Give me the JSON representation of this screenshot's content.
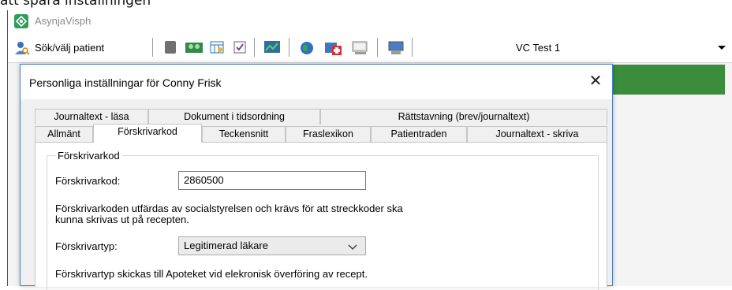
{
  "caption": "att spara inställningen",
  "app": {
    "title": "AsynjaVisph",
    "toolbar": {
      "search_label": "Sök/välj patient",
      "unit_label": "VC Test 1",
      "icons": [
        "user-search-icon",
        "notebook-icon",
        "patients-icon",
        "calendar-icon",
        "checklist-icon",
        "monitor-chart-icon",
        "globe-icon",
        "medical-kit-icon",
        "keyboard-icon",
        "computer-icon"
      ]
    }
  },
  "dialog": {
    "title": "Personliga inställningar för Conny Frisk",
    "close_glyph": "✕",
    "tabs_back": [
      "Journaltext - läsa",
      "Dokument i tidsordning",
      "Rättstavning (brev/journaltext)"
    ],
    "tabs_front": [
      "Allmänt",
      "Förskrivarkod",
      "Teckensnitt",
      "Fraslexikon",
      "Patientraden",
      "Journaltext - skriva"
    ],
    "active_tab": "Förskrivarkod",
    "group": {
      "legend": "Förskrivarkod",
      "code_label": "Förskrivarkod:",
      "code_value": "2860500",
      "code_info_line1": "Förskrivarkoden utfärdas av socialstyrelsen och krävs för att streckkoder ska",
      "code_info_line2": "kunna skrivas ut på recepten.",
      "type_label": "Förskrivartyp:",
      "type_value": "Legitimerad läkare",
      "type_info": "Förskrivartyp skickas till Apoteket vid elekronisk överföring av recept."
    }
  },
  "colors": {
    "accent_green": "#3b8d3b",
    "window_border": "#1c5f9e"
  }
}
